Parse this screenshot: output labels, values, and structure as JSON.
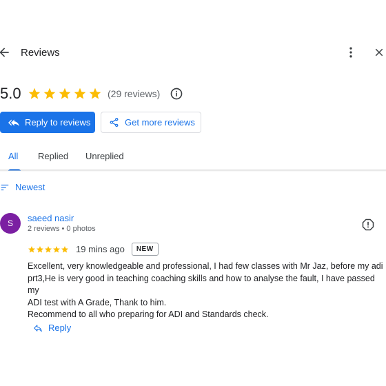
{
  "header": {
    "title": "Reviews",
    "back_icon": "arrow-back-icon",
    "more_icon": "more-vertical-icon",
    "close_icon": "close-icon"
  },
  "summary": {
    "rating": "5.0",
    "stars": 5,
    "review_count": "(29 reviews)",
    "star_color": "#fbbc04"
  },
  "actions": {
    "reply_label": "Reply to reviews",
    "get_more_label": "Get more reviews"
  },
  "tabs": [
    {
      "label": "All",
      "active": true
    },
    {
      "label": "Replied",
      "active": false
    },
    {
      "label": "Unreplied",
      "active": false
    }
  ],
  "sort": {
    "label": "Newest"
  },
  "reviews": [
    {
      "avatar_initial": "S",
      "avatar_color": "#7b1fa2",
      "name": "saeed nasir",
      "meta": "2 reviews • 0 photos",
      "stars": 5,
      "time_ago": "19 mins ago",
      "badge": "NEW",
      "text_lines": [
        "Excellent, very knowledgeable and professional, I had few classes with Mr Jaz, before my adi",
        "prt3,He is very good in teaching coaching skills and how to analyse the fault, I have passed my",
        "ADI test with A Grade, Thank to him.",
        "Recommend to all who preparing for ADI and Standards check."
      ],
      "reply_label": "Reply"
    }
  ],
  "colors": {
    "accent": "#1a73e8",
    "text": "#202124",
    "secondary_text": "#5f6368"
  }
}
